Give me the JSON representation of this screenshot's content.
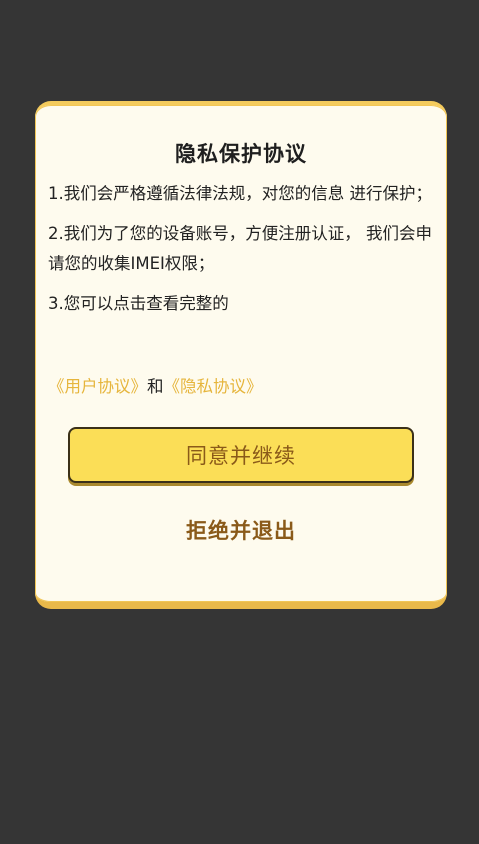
{
  "dialog": {
    "title": "隐私保护协议",
    "paragraphs": [
      "1.我们会严格遵循法律法规，对您的信息 进行保护；",
      "2.我们为了您的设备账号，方便注册认证， 我们会申请您的收集IMEI权限；",
      "3.您可以点击查看完整的"
    ],
    "user_agreement_link": "《用户协议》",
    "connector": "和",
    "privacy_agreement_link": "《隐私协议》",
    "agree_button": "同意并继续",
    "reject_button": "拒绝并退出"
  },
  "colors": {
    "backdrop": "#353535",
    "dialog_bg": "#fefbee",
    "accent": "#fbde57",
    "link": "#e6b53c",
    "button_text": "#8a5a19"
  }
}
